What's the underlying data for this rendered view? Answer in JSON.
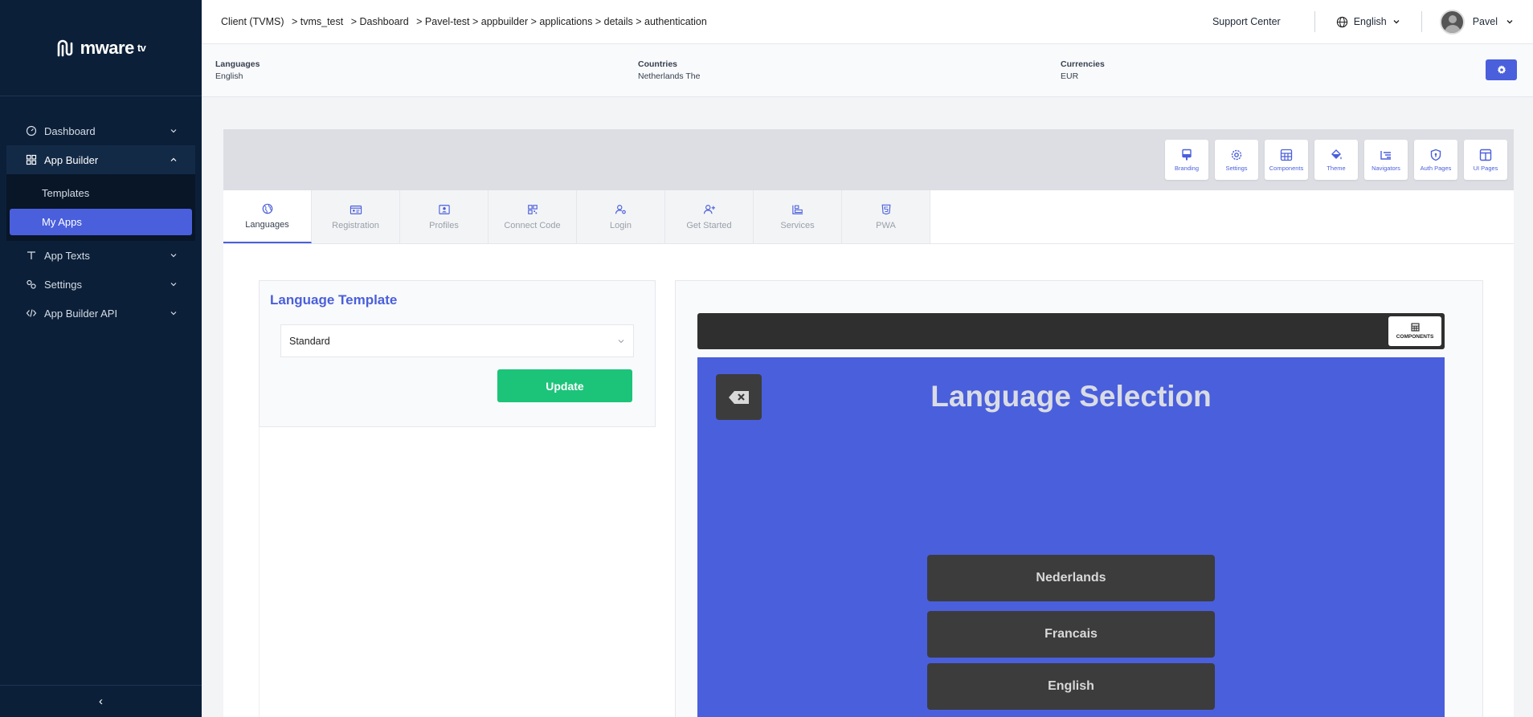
{
  "sidebar": {
    "brand": "mware",
    "brand_suffix": "tv",
    "items": [
      {
        "label": "Dashboard"
      },
      {
        "label": "App Builder"
      },
      {
        "label": "App Texts"
      },
      {
        "label": "Settings"
      },
      {
        "label": "App Builder API"
      }
    ],
    "app_builder_sub": [
      {
        "label": "Templates"
      },
      {
        "label": "My Apps"
      }
    ],
    "collapse_glyph": "‹"
  },
  "header": {
    "breadcrumb": [
      "Client (TVMS)",
      "> tvms_test",
      "> Dashboard",
      "> Pavel-test > appbuilder > applications > details > authentication"
    ],
    "support": "Support Center",
    "language": "English",
    "user": "Pavel"
  },
  "info": {
    "languages_label": "Languages",
    "languages_value": "English",
    "countries_label": "Countries",
    "countries_value": "Netherlands The",
    "currencies_label": "Currencies",
    "currencies_value": "EUR"
  },
  "toolbar": [
    {
      "label": "Branding",
      "icon": "branding-icon"
    },
    {
      "label": "Settings",
      "icon": "gear-icon"
    },
    {
      "label": "Components",
      "icon": "components-icon"
    },
    {
      "label": "Theme",
      "icon": "paint-bucket-icon"
    },
    {
      "label": "Navigators",
      "icon": "list-icon"
    },
    {
      "label": "Auth Pages",
      "icon": "shield-icon"
    },
    {
      "label": "UI Pages",
      "icon": "layout-icon"
    }
  ],
  "tabs": [
    {
      "label": "Languages",
      "icon": "globe-icon"
    },
    {
      "label": "Registration",
      "icon": "id-card-icon"
    },
    {
      "label": "Profiles",
      "icon": "profile-icon"
    },
    {
      "label": "Connect Code",
      "icon": "qr-code-icon"
    },
    {
      "label": "Login",
      "icon": "user-key-icon"
    },
    {
      "label": "Get Started",
      "icon": "user-plus-icon"
    },
    {
      "label": "Services",
      "icon": "services-icon"
    },
    {
      "label": "PWA",
      "icon": "html5-icon"
    }
  ],
  "language_template": {
    "title": "Language Template",
    "selected": "Standard",
    "update_label": "Update"
  },
  "preview": {
    "components_label": "COMPONENTS",
    "title": "Language Selection",
    "languages": [
      "Nederlands",
      "Francais",
      "English"
    ]
  },
  "colors": {
    "sidebar_bg": "#0b1f38",
    "accent": "#4a5fdc",
    "update_green": "#1cc47a",
    "preview_button": "#3c3c3c"
  }
}
